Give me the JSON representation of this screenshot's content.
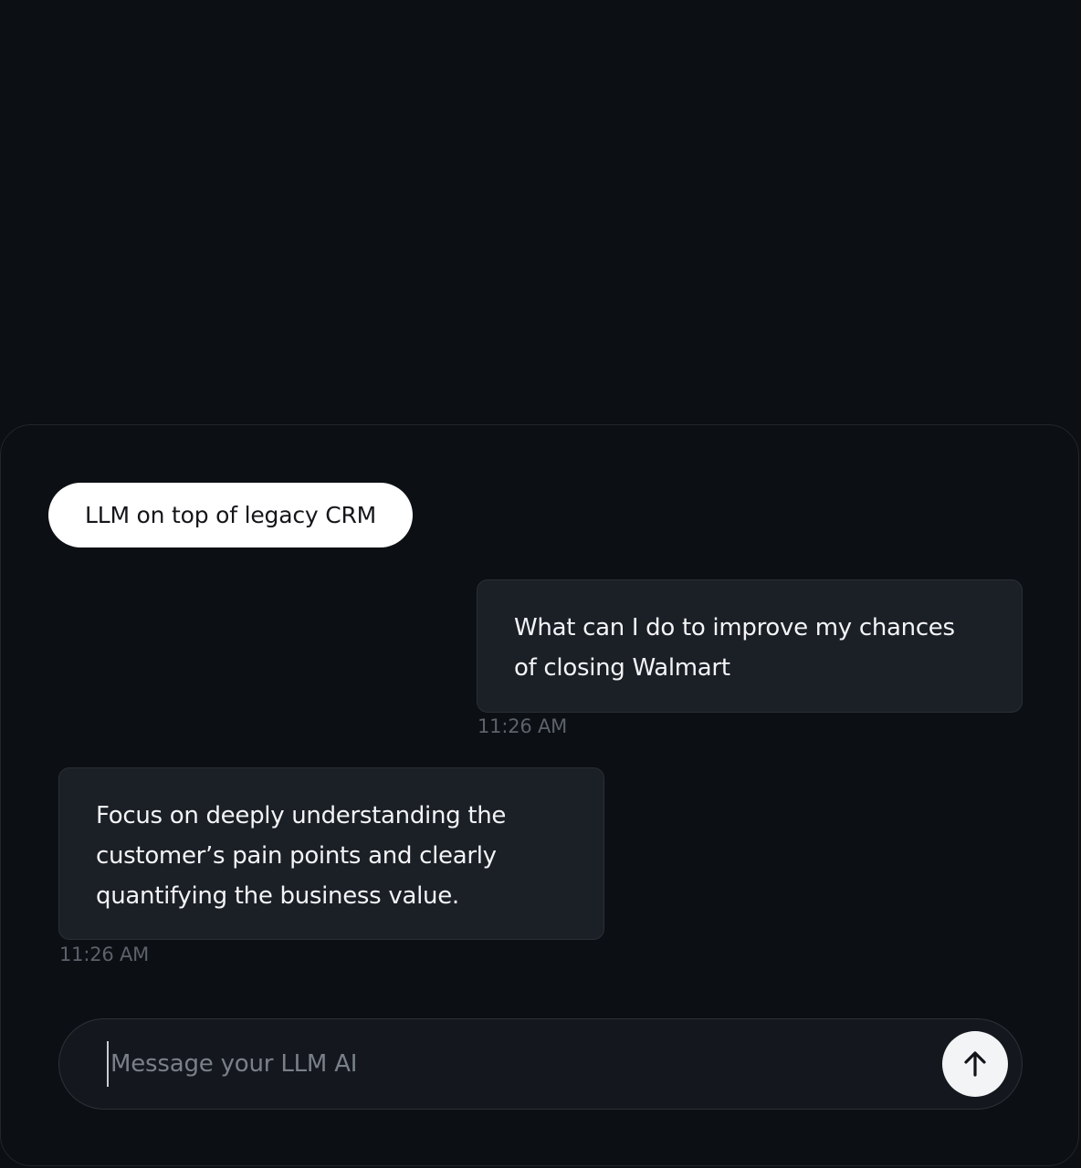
{
  "topic_chip": {
    "label": "LLM on top of legacy CRM"
  },
  "messages": [
    {
      "role": "user",
      "lines": [
        "What can I do to improve my chances",
        "of closing Walmart"
      ],
      "time": "11:26 AM"
    },
    {
      "role": "assistant",
      "lines": [
        "Focus on deeply understanding the",
        "customer’s pain points and clearly",
        "quantifying the business value."
      ],
      "time": "11:26 AM"
    }
  ],
  "composer": {
    "placeholder": "Message your LLM AI",
    "value": "",
    "send_icon": "arrow-up-icon"
  },
  "colors": {
    "background": "#0c0f13",
    "bubble": "#1b1f26",
    "chip": "#ffffff",
    "send_button": "#f3f4f5",
    "timestamp": "#5c626b"
  }
}
